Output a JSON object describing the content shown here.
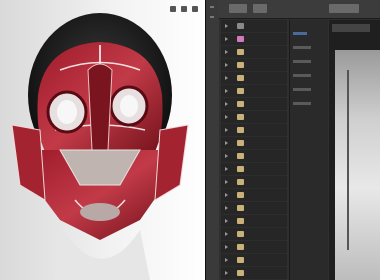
{
  "app": {
    "accent": "#4a6a9a",
    "viewport_bg": "#efefef",
    "panel_bg": "#2f2f2f"
  },
  "viewport": {
    "subject": "mask-render",
    "icons": [
      "tool-icon",
      "view-icon",
      "menu-icon",
      "grip-icon"
    ]
  },
  "file_browser": {
    "folder_icon": "folder-icon",
    "rows": 21
  }
}
